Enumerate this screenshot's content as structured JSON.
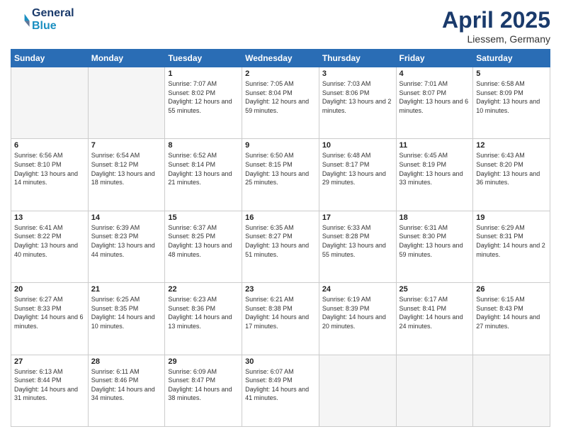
{
  "header": {
    "logo_line1": "General",
    "logo_line2": "Blue",
    "month": "April 2025",
    "location": "Liessem, Germany"
  },
  "days_of_week": [
    "Sunday",
    "Monday",
    "Tuesday",
    "Wednesday",
    "Thursday",
    "Friday",
    "Saturday"
  ],
  "weeks": [
    [
      {
        "day": "",
        "info": ""
      },
      {
        "day": "",
        "info": ""
      },
      {
        "day": "1",
        "info": "Sunrise: 7:07 AM\nSunset: 8:02 PM\nDaylight: 12 hours and 55 minutes."
      },
      {
        "day": "2",
        "info": "Sunrise: 7:05 AM\nSunset: 8:04 PM\nDaylight: 12 hours and 59 minutes."
      },
      {
        "day": "3",
        "info": "Sunrise: 7:03 AM\nSunset: 8:06 PM\nDaylight: 13 hours and 2 minutes."
      },
      {
        "day": "4",
        "info": "Sunrise: 7:01 AM\nSunset: 8:07 PM\nDaylight: 13 hours and 6 minutes."
      },
      {
        "day": "5",
        "info": "Sunrise: 6:58 AM\nSunset: 8:09 PM\nDaylight: 13 hours and 10 minutes."
      }
    ],
    [
      {
        "day": "6",
        "info": "Sunrise: 6:56 AM\nSunset: 8:10 PM\nDaylight: 13 hours and 14 minutes."
      },
      {
        "day": "7",
        "info": "Sunrise: 6:54 AM\nSunset: 8:12 PM\nDaylight: 13 hours and 18 minutes."
      },
      {
        "day": "8",
        "info": "Sunrise: 6:52 AM\nSunset: 8:14 PM\nDaylight: 13 hours and 21 minutes."
      },
      {
        "day": "9",
        "info": "Sunrise: 6:50 AM\nSunset: 8:15 PM\nDaylight: 13 hours and 25 minutes."
      },
      {
        "day": "10",
        "info": "Sunrise: 6:48 AM\nSunset: 8:17 PM\nDaylight: 13 hours and 29 minutes."
      },
      {
        "day": "11",
        "info": "Sunrise: 6:45 AM\nSunset: 8:19 PM\nDaylight: 13 hours and 33 minutes."
      },
      {
        "day": "12",
        "info": "Sunrise: 6:43 AM\nSunset: 8:20 PM\nDaylight: 13 hours and 36 minutes."
      }
    ],
    [
      {
        "day": "13",
        "info": "Sunrise: 6:41 AM\nSunset: 8:22 PM\nDaylight: 13 hours and 40 minutes."
      },
      {
        "day": "14",
        "info": "Sunrise: 6:39 AM\nSunset: 8:23 PM\nDaylight: 13 hours and 44 minutes."
      },
      {
        "day": "15",
        "info": "Sunrise: 6:37 AM\nSunset: 8:25 PM\nDaylight: 13 hours and 48 minutes."
      },
      {
        "day": "16",
        "info": "Sunrise: 6:35 AM\nSunset: 8:27 PM\nDaylight: 13 hours and 51 minutes."
      },
      {
        "day": "17",
        "info": "Sunrise: 6:33 AM\nSunset: 8:28 PM\nDaylight: 13 hours and 55 minutes."
      },
      {
        "day": "18",
        "info": "Sunrise: 6:31 AM\nSunset: 8:30 PM\nDaylight: 13 hours and 59 minutes."
      },
      {
        "day": "19",
        "info": "Sunrise: 6:29 AM\nSunset: 8:31 PM\nDaylight: 14 hours and 2 minutes."
      }
    ],
    [
      {
        "day": "20",
        "info": "Sunrise: 6:27 AM\nSunset: 8:33 PM\nDaylight: 14 hours and 6 minutes."
      },
      {
        "day": "21",
        "info": "Sunrise: 6:25 AM\nSunset: 8:35 PM\nDaylight: 14 hours and 10 minutes."
      },
      {
        "day": "22",
        "info": "Sunrise: 6:23 AM\nSunset: 8:36 PM\nDaylight: 14 hours and 13 minutes."
      },
      {
        "day": "23",
        "info": "Sunrise: 6:21 AM\nSunset: 8:38 PM\nDaylight: 14 hours and 17 minutes."
      },
      {
        "day": "24",
        "info": "Sunrise: 6:19 AM\nSunset: 8:39 PM\nDaylight: 14 hours and 20 minutes."
      },
      {
        "day": "25",
        "info": "Sunrise: 6:17 AM\nSunset: 8:41 PM\nDaylight: 14 hours and 24 minutes."
      },
      {
        "day": "26",
        "info": "Sunrise: 6:15 AM\nSunset: 8:43 PM\nDaylight: 14 hours and 27 minutes."
      }
    ],
    [
      {
        "day": "27",
        "info": "Sunrise: 6:13 AM\nSunset: 8:44 PM\nDaylight: 14 hours and 31 minutes."
      },
      {
        "day": "28",
        "info": "Sunrise: 6:11 AM\nSunset: 8:46 PM\nDaylight: 14 hours and 34 minutes."
      },
      {
        "day": "29",
        "info": "Sunrise: 6:09 AM\nSunset: 8:47 PM\nDaylight: 14 hours and 38 minutes."
      },
      {
        "day": "30",
        "info": "Sunrise: 6:07 AM\nSunset: 8:49 PM\nDaylight: 14 hours and 41 minutes."
      },
      {
        "day": "",
        "info": ""
      },
      {
        "day": "",
        "info": ""
      },
      {
        "day": "",
        "info": ""
      }
    ]
  ]
}
